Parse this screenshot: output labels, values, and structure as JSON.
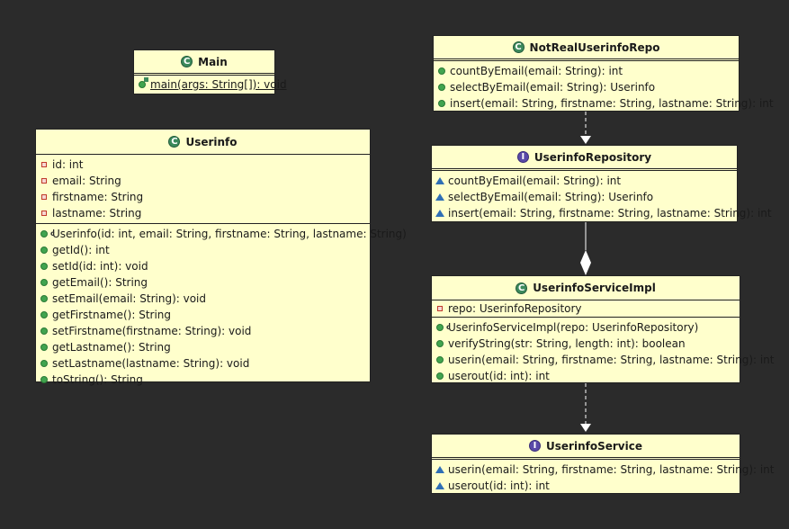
{
  "classes": {
    "main": {
      "name": "Main",
      "methods": [
        "main(args: String[]): void"
      ]
    },
    "userinfo": {
      "name": "Userinfo",
      "fields": [
        "id: int",
        "email: String",
        "firstname: String",
        "lastname: String"
      ],
      "methods": [
        "Userinfo(id: int, email: String, firstname: String, lastname: String)",
        "getId(): int",
        "setId(id: int): void",
        "getEmail(): String",
        "setEmail(email: String): void",
        "getFirstname(): String",
        "setFirstname(firstname: String): void",
        "getLastname(): String",
        "setLastname(lastname: String): void",
        "toString(): String"
      ]
    },
    "notreal": {
      "name": "NotRealUserinfoRepo",
      "methods": [
        "countByEmail(email: String): int",
        "selectByEmail(email: String): Userinfo",
        "insert(email: String, firstname: String, lastname: String): int"
      ]
    },
    "repository": {
      "name": "UserinfoRepository",
      "methods": [
        "countByEmail(email: String): int",
        "selectByEmail(email: String): Userinfo",
        "insert(email: String, firstname: String, lastname: String): int"
      ]
    },
    "serviceimpl": {
      "name": "UserinfoServiceImpl",
      "fields": [
        "repo: UserinfoRepository"
      ],
      "methods": [
        "UserinfoServiceImpl(repo: UserinfoRepository)",
        "verifyString(str: String, length: int): boolean",
        "userin(email: String, firstname: String, lastname: String): int",
        "userout(id: int): int"
      ]
    },
    "service": {
      "name": "UserinfoService",
      "methods": [
        "userin(email: String, firstname: String, lastname: String): int",
        "userout(id: int): int"
      ]
    }
  },
  "icons": {
    "class": "class-icon",
    "interface": "interface-icon",
    "public_method": "public-method-icon",
    "private_field": "private-field-icon",
    "abstract_method": "abstract-method-icon"
  },
  "colors": {
    "background": "#2b2b2b",
    "class_fill": "#ffffcc",
    "class_icon": "#3c8a5c",
    "interface_icon": "#5a4aa8"
  }
}
